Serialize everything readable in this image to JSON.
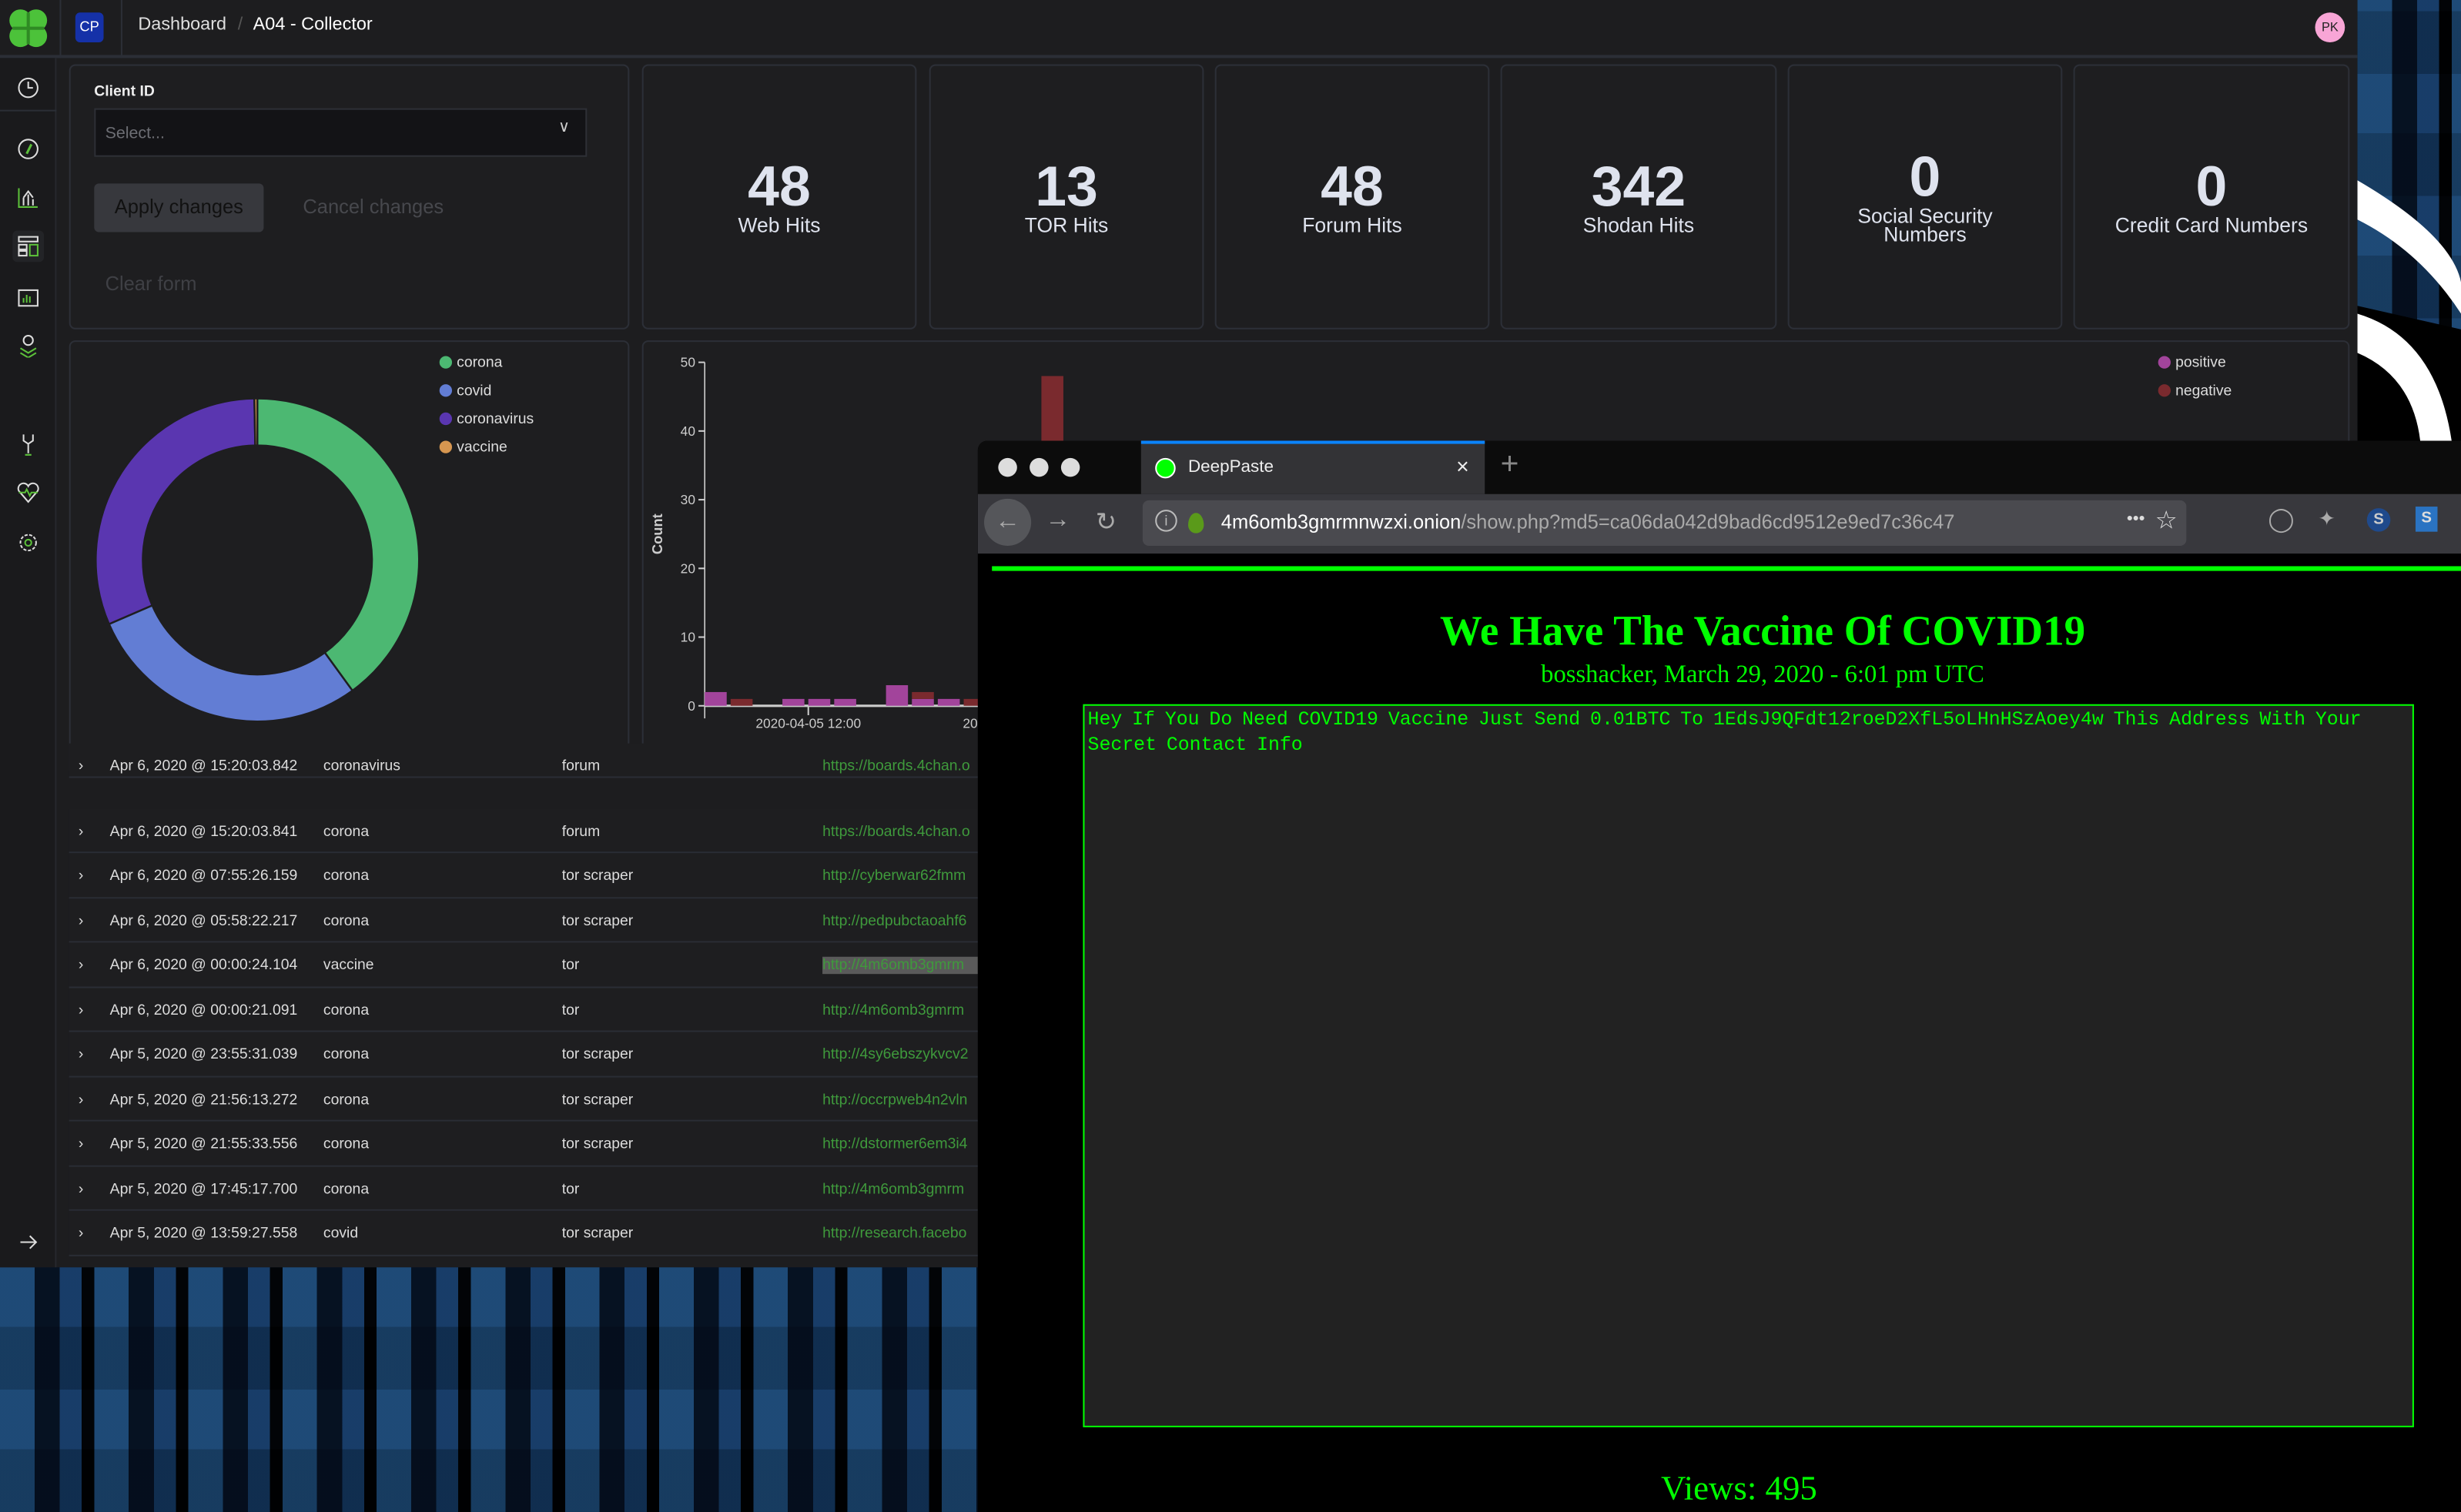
{
  "topbar": {
    "app_badge": "CP",
    "breadcrumb": [
      "Dashboard",
      "A04 - Collector"
    ],
    "avatar": "PK"
  },
  "sidebar": {
    "icons": [
      "clock-icon",
      "compass-icon",
      "visualize-icon",
      "dashboard-icon",
      "canvas-icon",
      "maps-icon",
      "wrench-icon",
      "heartbeat-icon",
      "gear-icon",
      "expand-arrow-icon"
    ]
  },
  "form": {
    "label": "Client ID",
    "placeholder": "Select...",
    "apply": "Apply changes",
    "cancel": "Cancel changes",
    "clear": "Clear form"
  },
  "stats": [
    {
      "value": "48",
      "label": "Web Hits"
    },
    {
      "value": "13",
      "label": "TOR Hits"
    },
    {
      "value": "48",
      "label": "Forum Hits"
    },
    {
      "value": "342",
      "label": "Shodan Hits"
    },
    {
      "value": "0",
      "label": "Social Security Numbers"
    },
    {
      "value": "0",
      "label": "Credit Card Numbers"
    }
  ],
  "colors": {
    "accent": "#5cc03a",
    "corona": "#4cb872",
    "covid": "#627dd4",
    "coronavirus": "#5a36b0",
    "vaccine": "#d69650",
    "positive": "#a2449b",
    "negative": "#7a2a2e",
    "paste_green": "#00ff00",
    "tab_blue": "#0a84ff"
  },
  "chart_data": [
    {
      "type": "pie",
      "donut": true,
      "categories": [
        "corona",
        "covid",
        "coronavirus",
        "vaccine"
      ],
      "values": [
        40,
        28.5,
        31.2,
        0.3
      ],
      "legend": "top-right"
    },
    {
      "type": "bar",
      "stacked": true,
      "ylabel": "Count",
      "ylim": [
        0,
        50
      ],
      "yticks": [
        0,
        10,
        20,
        30,
        40,
        50
      ],
      "x": [
        "2020-04-05 00:00",
        "2020-04-05 03:00",
        "2020-04-05 06:00",
        "2020-04-05 09:00",
        "2020-04-05 12:00",
        "2020-04-05 15:00",
        "2020-04-05 18:00",
        "2020-04-05 21:00",
        "2020-04-06 00:00",
        "2020-04-06 03:00",
        "2020-04-06 06:00",
        "2020-04-06 09:00",
        "2020-04-06 12:00",
        "2020-04-06 15:00"
      ],
      "xtick_labels": [
        "2020-04-05 12:00",
        "2020-04-06 12:00"
      ],
      "series": [
        {
          "name": "positive",
          "values": [
            2,
            0,
            0,
            1,
            1,
            1,
            0,
            3,
            1,
            1,
            0,
            0,
            0,
            0
          ]
        },
        {
          "name": "negative",
          "values": [
            0,
            1,
            0,
            0,
            0,
            0,
            0,
            0,
            1,
            0,
            1,
            0,
            0,
            48
          ]
        }
      ],
      "legend": "top-right"
    }
  ],
  "table": {
    "rows": [
      [
        "Apr 6, 2020 @ 15:20:03.842",
        "coronavirus",
        "forum",
        "https://boards.4chan.o"
      ],
      [
        "Apr 6, 2020 @ 15:20:03.841",
        "corona",
        "forum",
        "https://boards.4chan.o"
      ],
      [
        "Apr 6, 2020 @ 07:55:26.159",
        "corona",
        "tor scraper",
        "http://cyberwar62fmm"
      ],
      [
        "Apr 6, 2020 @ 05:58:22.217",
        "corona",
        "tor scraper",
        "http://pedpubctaoahf6"
      ],
      [
        "Apr 6, 2020 @ 00:00:24.104",
        "vaccine",
        "tor",
        "http://4m6omb3gmrm"
      ],
      [
        "Apr 6, 2020 @ 00:00:21.091",
        "corona",
        "tor",
        "http://4m6omb3gmrm"
      ],
      [
        "Apr 5, 2020 @ 23:55:31.039",
        "corona",
        "tor scraper",
        "http://4sy6ebszykvcv2"
      ],
      [
        "Apr 5, 2020 @ 21:56:13.272",
        "corona",
        "tor scraper",
        "http://occrpweb4n2vln"
      ],
      [
        "Apr 5, 2020 @ 21:55:33.556",
        "corona",
        "tor scraper",
        "http://dstormer6em3i4"
      ],
      [
        "Apr 5, 2020 @ 17:45:17.700",
        "corona",
        "tor",
        "http://4m6omb3gmrm"
      ],
      [
        "Apr 5, 2020 @ 13:59:27.558",
        "covid",
        "tor scraper",
        "http://research.facebo"
      ]
    ]
  },
  "browser": {
    "tab_title": "DeepPaste",
    "url_host": "4m6omb3gmrmnwzxi.onion",
    "url_path": "/show.php?md5=ca06da042d9bad6cd9512e9ed7c36c47",
    "menu": "•••"
  },
  "paste": {
    "title": "We Have The Vaccine Of COVID19",
    "byline": "bosshacker, March 29, 2020 - 6:01 pm UTC",
    "body": "Hey If You Do Need COVID19 Vaccine Just Send 0.01BTC To 1EdsJ9QFdt12roeD2XfL5oLHnHSzAoey4w This Address With Your Secret Contact Info",
    "views": "Views: 495"
  }
}
